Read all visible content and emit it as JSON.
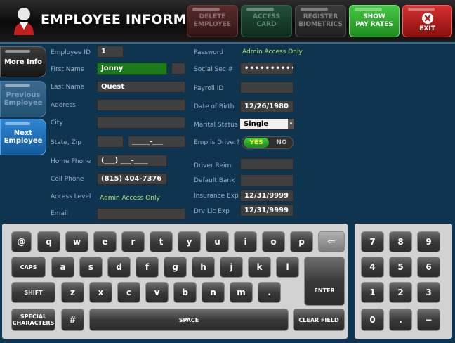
{
  "header": {
    "title": "EMPLOYEE INFORMATION",
    "buttons": {
      "delete": "DELETE\nEMPLOYEE",
      "access": "ACCESS\nCARD",
      "register": "REGISTER\nBIOMETRICS",
      "show_pay": "SHOW\nPAY RATES",
      "exit": "EXIT"
    }
  },
  "sidebar": {
    "more_info": "More Info",
    "previous": "Previous\nEmployee",
    "next": "Next\nEmployee"
  },
  "form": {
    "employee_id": {
      "label": "Employee ID",
      "value": "1"
    },
    "first_name": {
      "label": "First Name",
      "value": "Jonny"
    },
    "last_name": {
      "label": "Last Name",
      "value": "Quest"
    },
    "address": {
      "label": "Address",
      "value": ""
    },
    "city": {
      "label": "City",
      "value": ""
    },
    "state_zip": {
      "label": "State, Zip",
      "state": "",
      "zip": "_____-___"
    },
    "home_phone": {
      "label": "Home Phone",
      "value": "(___) ___-____"
    },
    "cell_phone": {
      "label": "Cell Phone",
      "value": "(815) 404-7376"
    },
    "access_level": {
      "label": "Access Level",
      "value": "Admin Access Only"
    },
    "email": {
      "label": "Email",
      "value": ""
    },
    "password": {
      "label": "Password",
      "value": "Admin Access Only"
    },
    "ssn": {
      "label": "Social Sec #",
      "value": "••••••••••"
    },
    "payroll_id": {
      "label": "Payroll ID",
      "value": ""
    },
    "dob": {
      "label": "Date of Birth",
      "value": "12/26/1980"
    },
    "marital_status": {
      "label": "Marital Status",
      "value": "Single"
    },
    "driver": {
      "label": "Emp is Driver?",
      "yes": "YES",
      "no": "NO"
    },
    "driver_reim": {
      "label": "Driver Reim",
      "value": ""
    },
    "default_bank": {
      "label": "Default Bank",
      "value": ""
    },
    "insurance_exp": {
      "label": "Insurance Exp",
      "value": "12/31/9999"
    },
    "drv_lic_exp": {
      "label": "Drv Lic Exp",
      "value": "12/31/9999"
    }
  },
  "keyboard": {
    "row1": [
      "@",
      "q",
      "w",
      "e",
      "r",
      "t",
      "y",
      "u",
      "i",
      "o",
      "p",
      "⇐"
    ],
    "row2": [
      "CAPS",
      "a",
      "s",
      "d",
      "f",
      "g",
      "h",
      "j",
      "k",
      "l"
    ],
    "row3": [
      "SHIFT",
      "z",
      "x",
      "c",
      "v",
      "b",
      "n",
      "m",
      "."
    ],
    "enter": "ENTER",
    "special": "SPECIAL\nCHARACTERS",
    "hash": "#",
    "space": "SPACE",
    "clear": "CLEAR FIELD"
  },
  "numpad": {
    "row1": [
      "7",
      "8",
      "9"
    ],
    "row2": [
      "4",
      "5",
      "6"
    ],
    "row3": [
      "1",
      "2",
      "3"
    ],
    "row4": [
      "0",
      ".",
      "−"
    ]
  },
  "colors": {
    "background": "#0e3450",
    "label": "#9db2c4",
    "field": "#3f3f3f",
    "active_field": "#1a7a1a",
    "static_green": "#b6e36a",
    "show_pay_green": "#2fa82f",
    "exit_red": "#b51f1f"
  },
  "icons": {
    "logo": "person-icon",
    "exit": "close-icon",
    "backspace": "backspace-arrow-icon"
  }
}
